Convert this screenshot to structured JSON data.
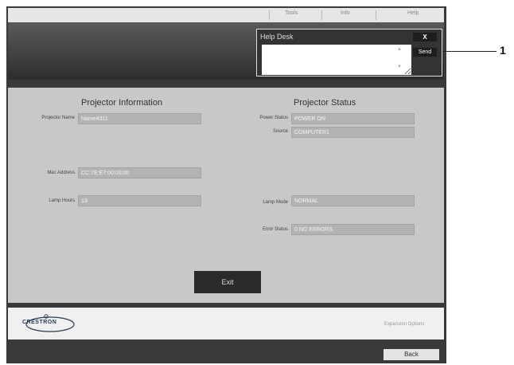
{
  "topbar": {
    "tabs": [
      "Tools",
      "Info",
      "Help"
    ]
  },
  "help_desk": {
    "title": "Help Desk",
    "close_label": "X",
    "send_label": "Send",
    "message_value": ""
  },
  "callout": {
    "number": "1"
  },
  "projector_information": {
    "title": "Projector Information",
    "fields": [
      {
        "label": "Projector Name",
        "value": "Name4311"
      },
      {
        "label": "Mac Address",
        "value": "CC:7E:E7:00:00:00"
      },
      {
        "label": "Lamp Hours",
        "value": "13"
      }
    ]
  },
  "projector_status": {
    "title": "Projector Status",
    "fields": [
      {
        "label": "Power Status",
        "value": "POWER ON"
      },
      {
        "label": "Source",
        "value": "COMPUTER1"
      },
      {
        "label": "Lamp Mode",
        "value": "NORMAL"
      },
      {
        "label": "Error Status",
        "value": "0:NO ERRORS"
      }
    ]
  },
  "exit_label": "Exit",
  "footer": {
    "logo_text": "CRESTRON",
    "expansion_options": "Expansion Options"
  },
  "back_label": "Back",
  "icons": {
    "close": "close-icon",
    "scroll_up": "scroll-up-icon",
    "scroll_down": "scroll-down-icon",
    "logo": "crestron-logo"
  }
}
